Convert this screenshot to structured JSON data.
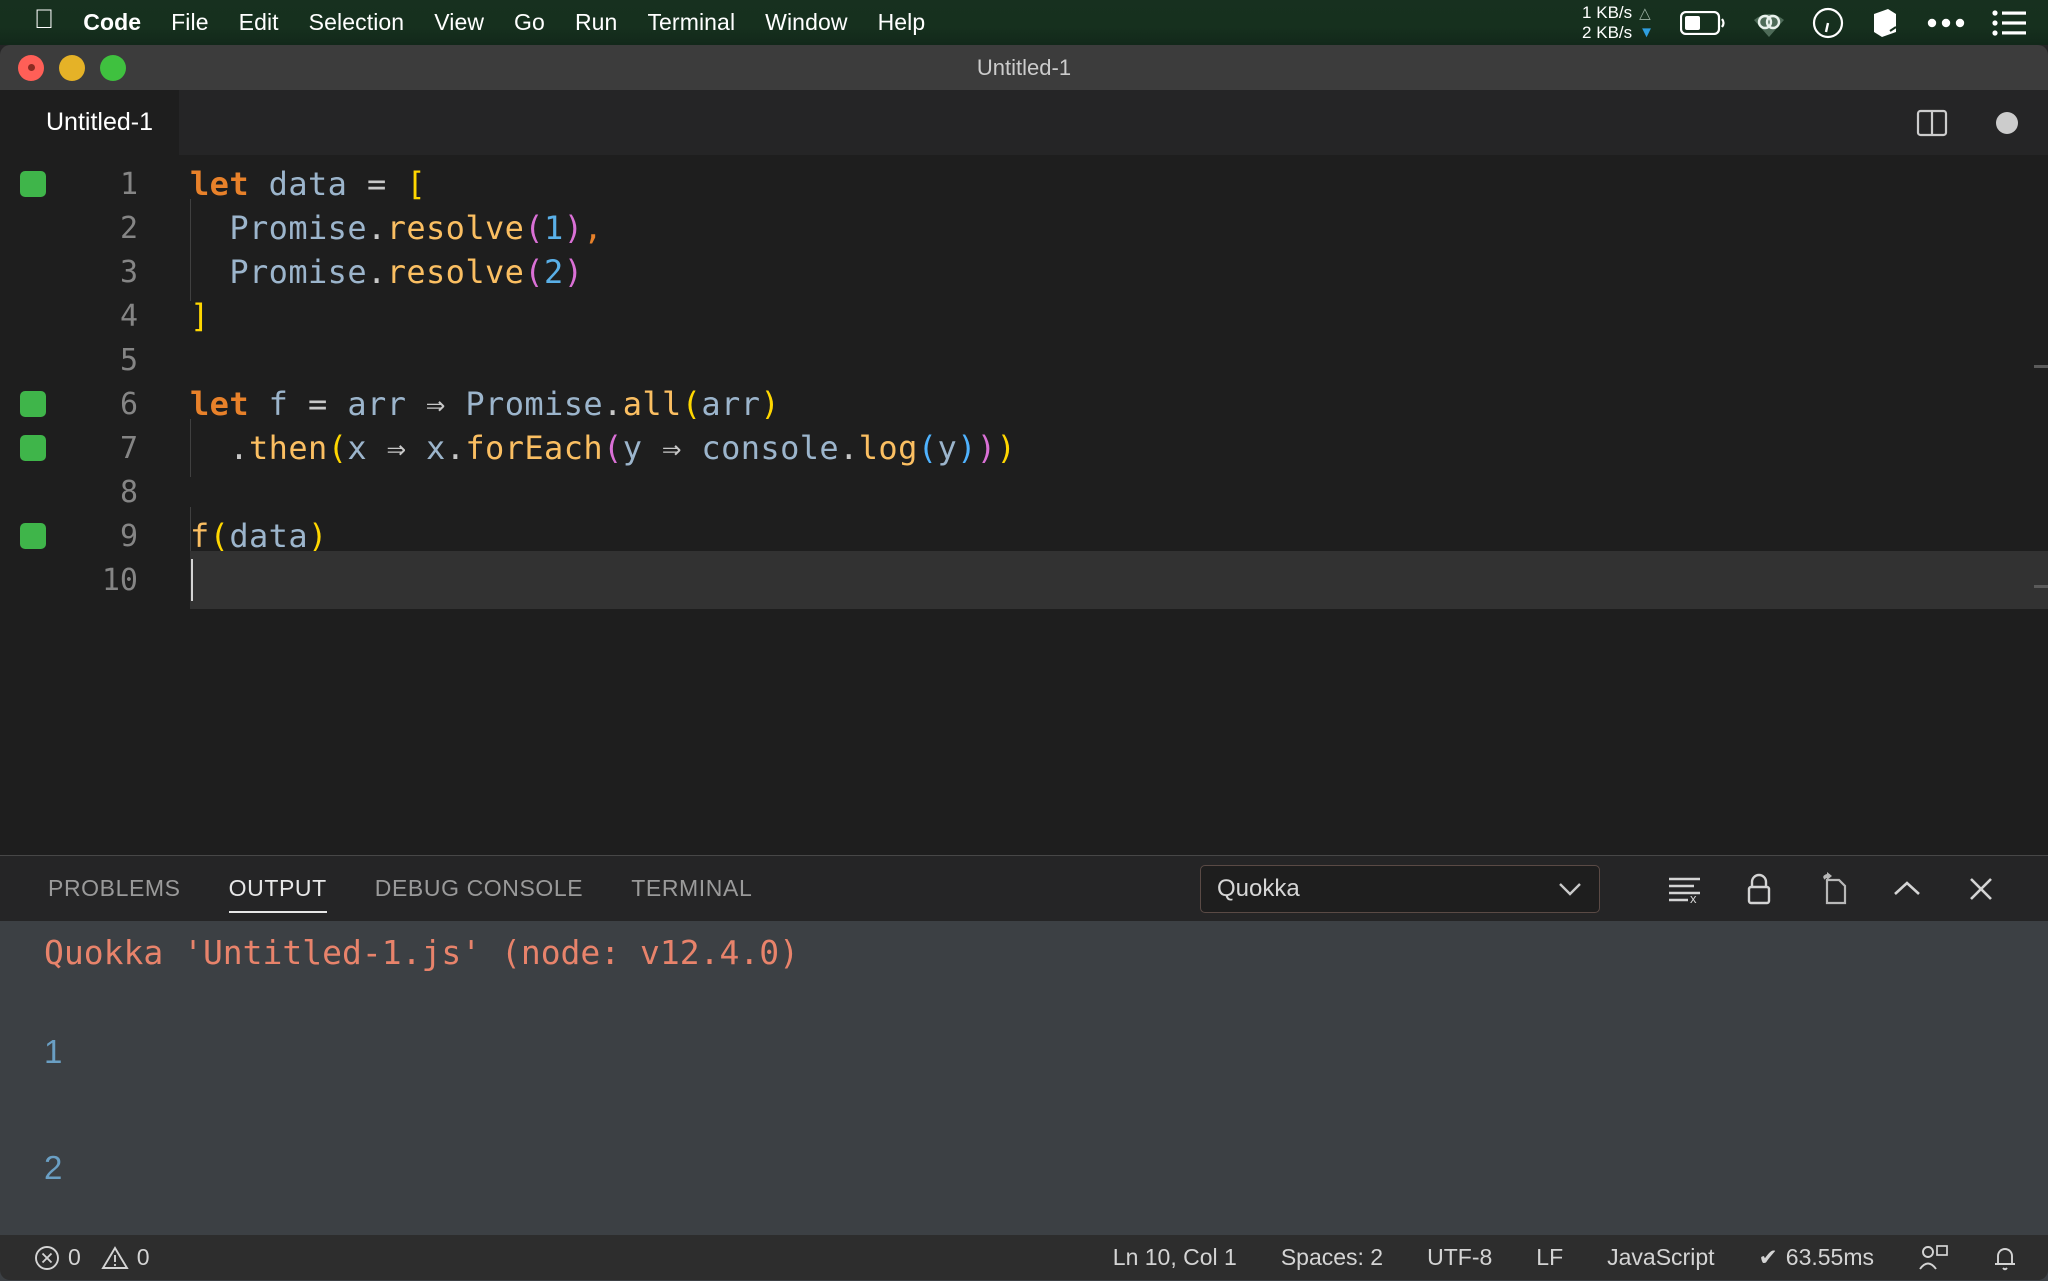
{
  "menubar": {
    "apple_icon": "apple-icon",
    "items": [
      {
        "label": "Code",
        "bold": true
      },
      {
        "label": "File",
        "bold": false
      },
      {
        "label": "Edit",
        "bold": false
      },
      {
        "label": "Selection",
        "bold": false
      },
      {
        "label": "View",
        "bold": false
      },
      {
        "label": "Go",
        "bold": false
      },
      {
        "label": "Run",
        "bold": false
      },
      {
        "label": "Terminal",
        "bold": false
      },
      {
        "label": "Window",
        "bold": false
      },
      {
        "label": "Help",
        "bold": false
      }
    ],
    "network": {
      "upload": "1 KB/s",
      "download": "2 KB/s"
    },
    "status_icons": [
      "battery-icon",
      "vpn-icon",
      "speedometer-icon",
      "box-icon",
      "ellipsis-icon",
      "control-center-icon"
    ]
  },
  "window": {
    "title": "Untitled-1",
    "traffic_lights": [
      "close-button",
      "minimize-button",
      "maximize-button"
    ]
  },
  "tabbar": {
    "tabs": [
      {
        "label": "Untitled-1",
        "active": true
      }
    ],
    "actions": [
      "split-editor-icon",
      "unsaved-dot-icon"
    ]
  },
  "editor": {
    "language": "JavaScript",
    "lines": [
      {
        "num": "1",
        "marker": true,
        "indent_guide": false,
        "active": false
      },
      {
        "num": "2",
        "marker": false,
        "indent_guide": true,
        "active": false
      },
      {
        "num": "3",
        "marker": false,
        "indent_guide": true,
        "active": false
      },
      {
        "num": "4",
        "marker": false,
        "indent_guide": false,
        "active": false
      },
      {
        "num": "5",
        "marker": false,
        "indent_guide": false,
        "active": false
      },
      {
        "num": "6",
        "marker": true,
        "indent_guide": false,
        "active": false
      },
      {
        "num": "7",
        "marker": true,
        "indent_guide": true,
        "active": false
      },
      {
        "num": "8",
        "marker": false,
        "indent_guide": false,
        "active": false
      },
      {
        "num": "9",
        "marker": true,
        "indent_guide": true,
        "active": false
      },
      {
        "num": "10",
        "marker": false,
        "indent_guide": false,
        "active": true
      }
    ],
    "source_text": [
      "let data = [",
      "  Promise.resolve(1),",
      "  Promise.resolve(2)",
      "]",
      "",
      "let f = arr ⇒ Promise.all(arr)",
      "  .then(x ⇒ x.forEach(y ⇒ console.log(y)))",
      "",
      "f(data)",
      ""
    ]
  },
  "panel": {
    "tabs": [
      {
        "label": "PROBLEMS",
        "active": false
      },
      {
        "label": "OUTPUT",
        "active": true
      },
      {
        "label": "DEBUG CONSOLE",
        "active": false
      },
      {
        "label": "TERMINAL",
        "active": false
      }
    ],
    "channel": {
      "value": "Quokka",
      "options": [
        "Quokka"
      ]
    },
    "actions": [
      "clear-output-icon",
      "lock-scroll-icon",
      "open-in-editor-icon",
      "collapse-panel-icon",
      "close-panel-icon"
    ],
    "output": {
      "header": "Quokka 'Untitled-1.js' (node: v12.4.0)",
      "values": [
        "1",
        "2"
      ]
    }
  },
  "statusbar": {
    "errors": "0",
    "warnings": "0",
    "position": "Ln 10, Col 1",
    "indentation": "Spaces: 2",
    "encoding": "UTF-8",
    "eol": "LF",
    "language": "JavaScript",
    "quokka_time": "63.55ms",
    "quokka_check": "✔",
    "right_icons": [
      "feedback-icon",
      "bell-icon"
    ]
  },
  "colors": {
    "menubar_bg": "#16301e",
    "editor_bg": "#1e1e1e",
    "panel_bg": "#3c4044",
    "accent_keyword": "#e8812a",
    "accent_function": "#fbbf62",
    "bracket1": "#ffd700",
    "bracket2": "#da70d6",
    "bracket3": "#4fb3ff",
    "output_header": "#e8836b",
    "output_value": "#6a9fc4",
    "gutter_marker": "#3fb54a"
  }
}
